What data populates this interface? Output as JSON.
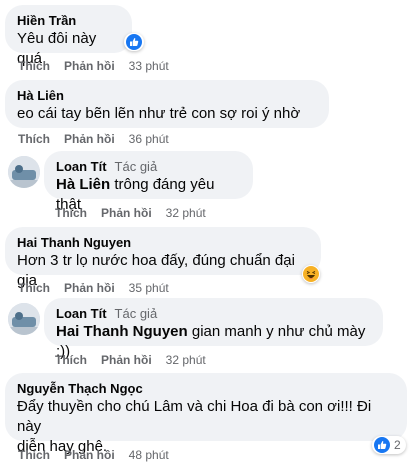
{
  "comments": [
    {
      "author": "Hiền Trần",
      "text": "Yêu đôi này quá",
      "like": "Thích",
      "reply": "Phản hồi",
      "time": "33 phút"
    },
    {
      "author": "Hà Liên",
      "text": "eo cái tay bẽn lẽn như trẻ con sợ roi ý nhờ",
      "like": "Thích",
      "reply": "Phản hồi",
      "time": "36 phút"
    },
    {
      "author": "Loan Tít",
      "badge": "Tác giả",
      "mention": "Hà Liên",
      "text": "trông đáng yêu thật",
      "like": "Thích",
      "reply": "Phản hồi",
      "time": "32 phút"
    },
    {
      "author": "Hai Thanh Nguyen",
      "text": "Hơn 3 tr lọ nước hoa đấy, đúng chuẩn đại gia",
      "like": "Thích",
      "reply": "Phản hồi",
      "time": "35 phút"
    },
    {
      "author": "Loan Tít",
      "badge": "Tác giả",
      "mention": "Hai Thanh Nguyen",
      "text": "gian manh y như chủ mày :))",
      "like": "Thích",
      "reply": "Phản hồi",
      "time": "32 phút"
    },
    {
      "author": "Nguyễn Thạch Ngọc",
      "text_line1": "Đẩy thuyền cho chú Lâm và chi Hoa đi bà con ơi!!! Đi này",
      "text_line2": "diễn hay ghê.",
      "like": "Thích",
      "reply": "Phản hồi",
      "time": "48 phút",
      "reaction_count": "2"
    }
  ],
  "colors": {
    "bubble": "#f0f2f5",
    "secondary_text": "#65676b",
    "like_blue": "#1877f2",
    "haha_yellow": "#f7b125"
  },
  "icons": {
    "like": "like-icon",
    "haha": "haha-icon"
  }
}
